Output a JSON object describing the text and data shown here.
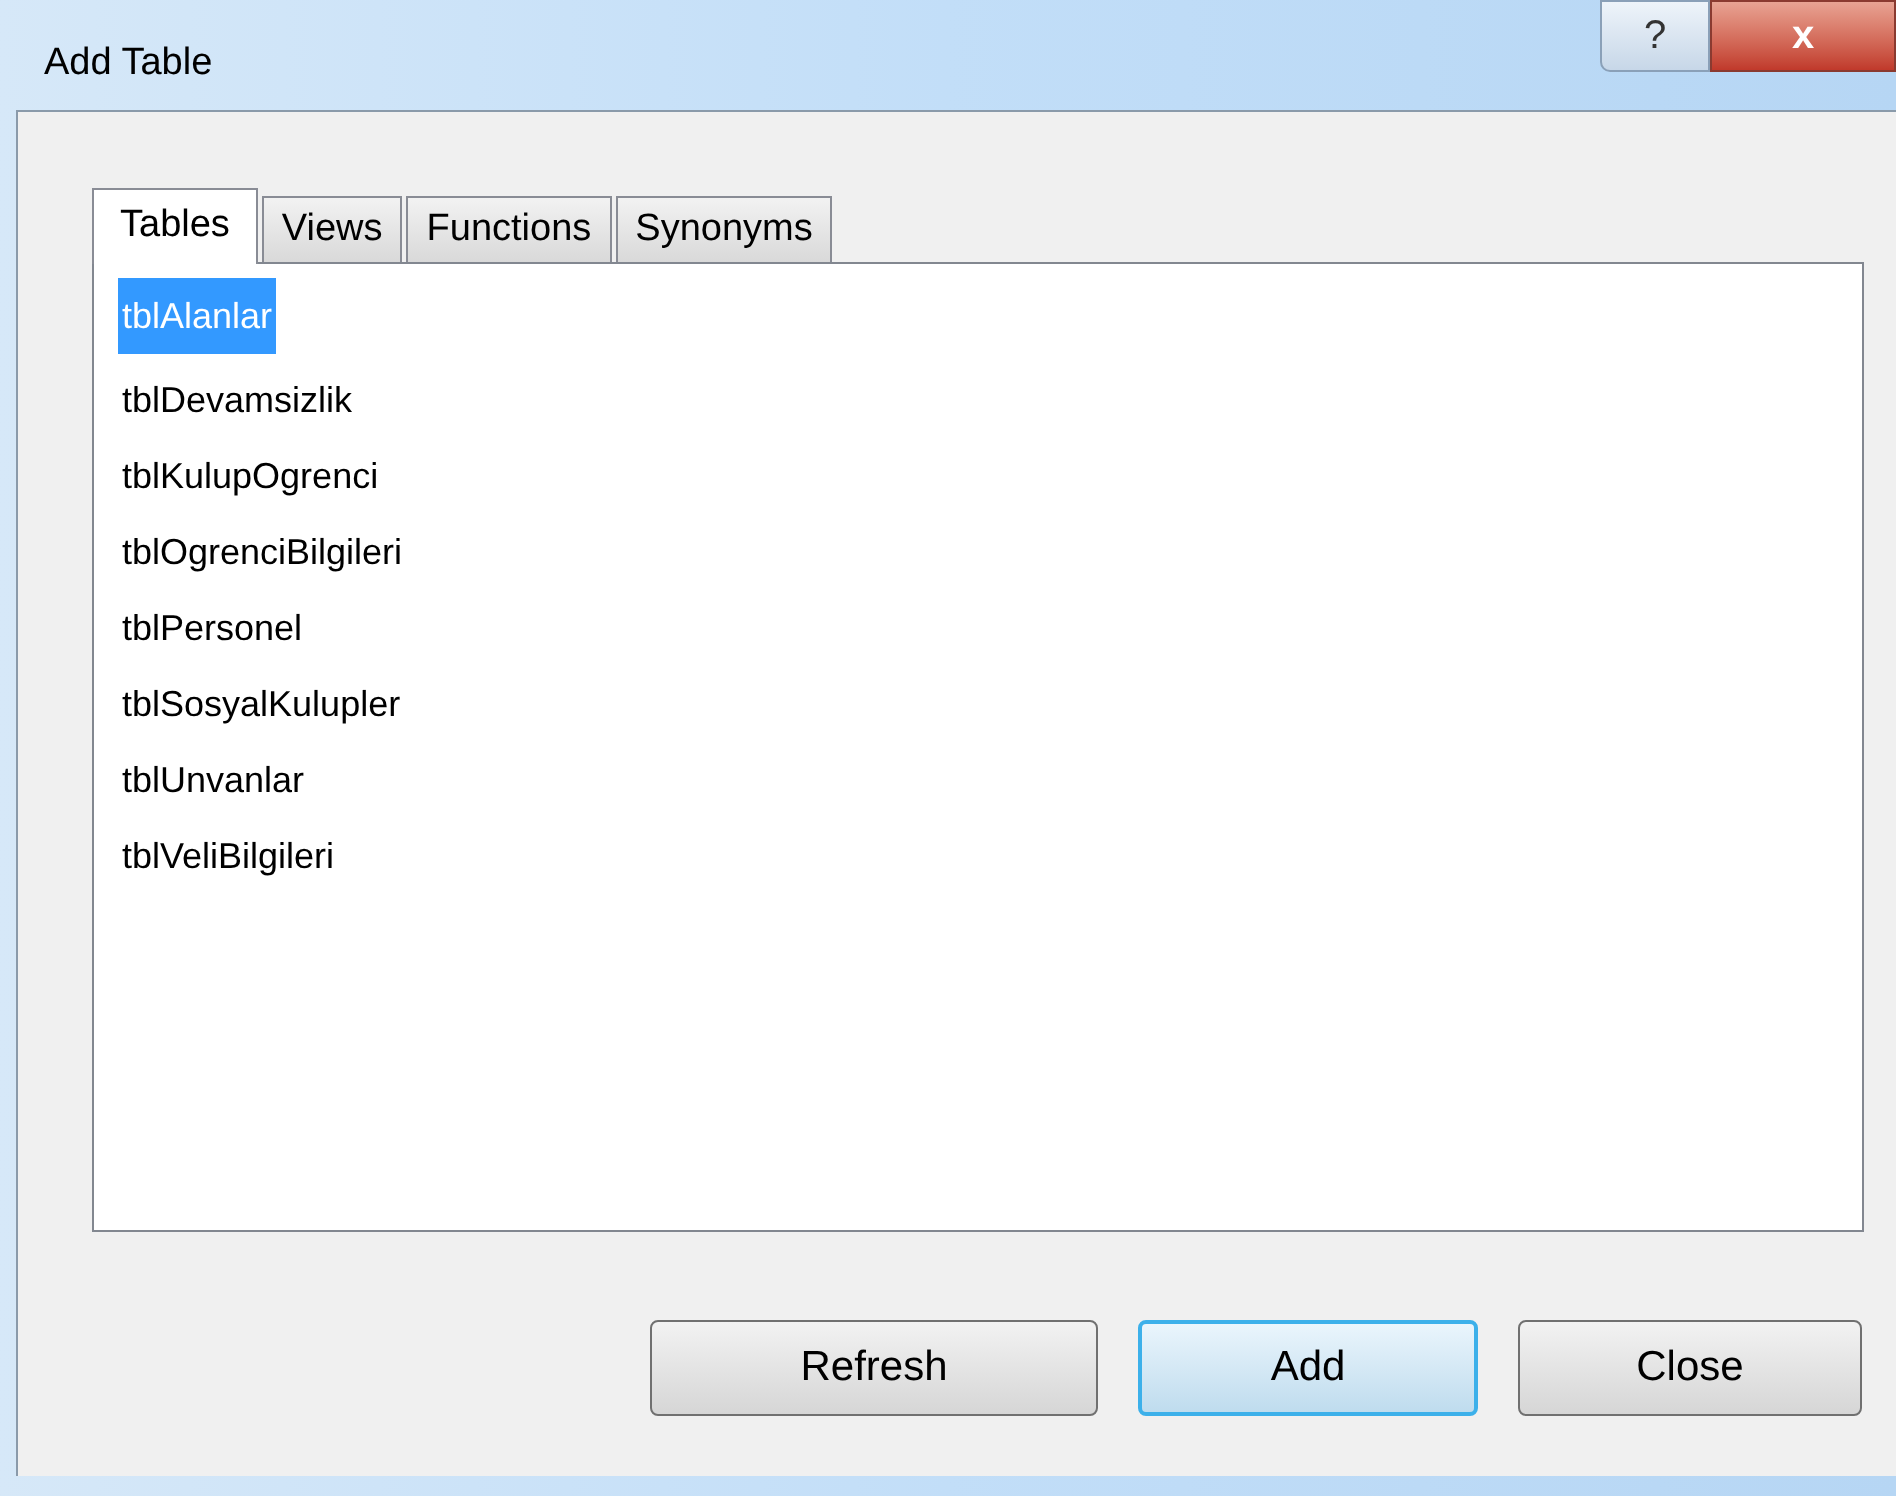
{
  "window": {
    "title": "Add Table",
    "help_glyph": "?",
    "close_glyph": "x"
  },
  "tabs": [
    {
      "label": "Tables",
      "selected": true
    },
    {
      "label": "Views",
      "selected": false
    },
    {
      "label": "Functions",
      "selected": false
    },
    {
      "label": "Synonyms",
      "selected": false
    }
  ],
  "list": [
    {
      "label": "tblAlanlar",
      "selected": true
    },
    {
      "label": "tblDevamsizlik",
      "selected": false
    },
    {
      "label": "tblKulupOgrenci",
      "selected": false
    },
    {
      "label": "tblOgrenciBilgileri",
      "selected": false
    },
    {
      "label": "tblPersonel",
      "selected": false
    },
    {
      "label": "tblSosyalKulupler",
      "selected": false
    },
    {
      "label": "tblUnvanlar",
      "selected": false
    },
    {
      "label": "tblVeliBilgileri",
      "selected": false
    }
  ],
  "buttons": [
    {
      "label": "Refresh",
      "default": false
    },
    {
      "label": "Add",
      "default": true
    },
    {
      "label": "Close",
      "default": false
    }
  ]
}
